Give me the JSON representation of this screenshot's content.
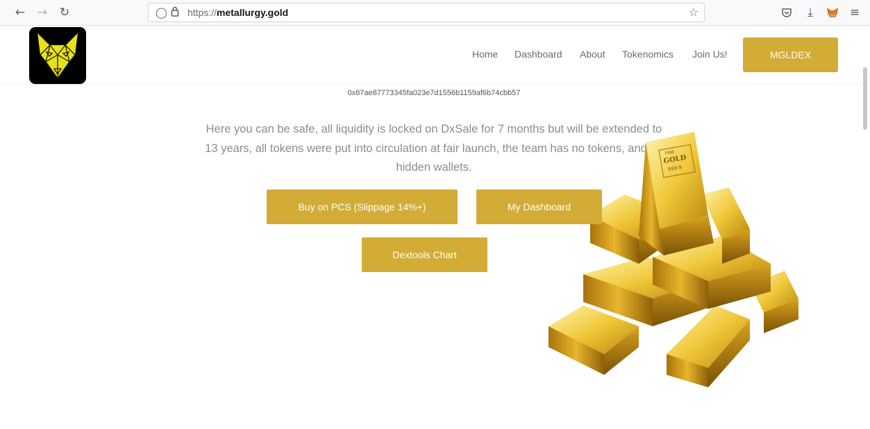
{
  "browser": {
    "url_prefix": "https://",
    "url_domain": "metallurgy.gold",
    "icons": {
      "back": "arrow-left-icon",
      "forward": "arrow-right-icon",
      "reload": "reload-icon",
      "shield": "tracking-shield-icon",
      "lock": "lock-icon",
      "bookmark": "star-icon",
      "pocket": "pocket-icon",
      "download": "download-icon",
      "extension": "metamask-fox-icon",
      "menu": "hamburger-menu-icon"
    }
  },
  "site": {
    "nav": [
      {
        "label": "Home"
      },
      {
        "label": "Dashboard"
      },
      {
        "label": "About"
      },
      {
        "label": "Tokenomics"
      },
      {
        "label": "Join Us!"
      }
    ],
    "cta_label": "MGLDEX",
    "contract_address": "0x87ae87773345fa023e7d1556b1159af6b74cbb57",
    "intro_text": "Here you can be safe, all liquidity is locked on DxSale for 7 months but will be extended to 13 years, all tokens were put into circulation at fair launch, the team has no tokens, and no hidden wallets.",
    "buttons": {
      "buy": "Buy on PCS (Slippage 14%+)",
      "dashboard": "My Dashboard",
      "chart": "Dextools Chart"
    },
    "gold_bar_stamp": {
      "line1": "FINE",
      "line2": "GOLD",
      "line3": "999.9"
    }
  },
  "colors": {
    "accent_gold": "#d2ac36",
    "text_gray": "#8c8c8c",
    "logo_bg": "#000000"
  }
}
